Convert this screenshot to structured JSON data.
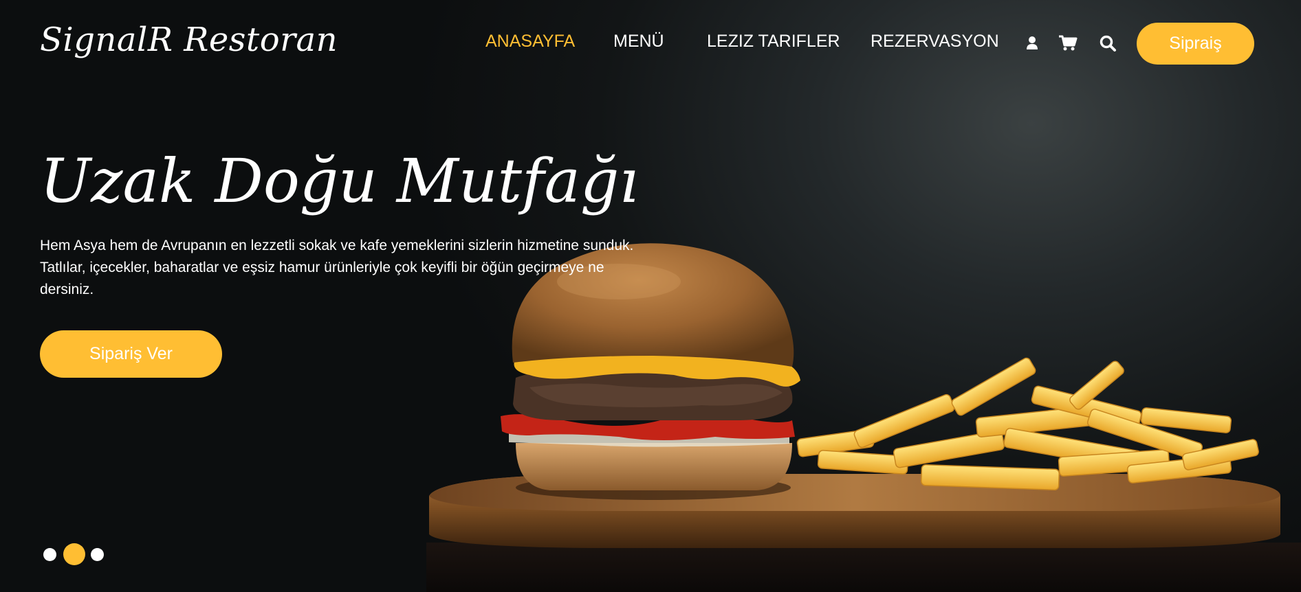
{
  "header": {
    "logo": "SignalR Restoran",
    "nav": [
      {
        "label": "ANASAYFA",
        "active": true
      },
      {
        "label": "MENÜ",
        "active": false
      },
      {
        "label": "LEZIZ TARIFLER",
        "active": false
      },
      {
        "label": "REZERVASYON",
        "active": false
      }
    ],
    "icons": [
      "user-icon",
      "cart-icon",
      "search-icon"
    ],
    "order_button": "Sipraiş"
  },
  "hero": {
    "title": "Uzak Doğu Mutfağı",
    "description": "Hem Asya hem de Avrupanın en lezzetli sokak ve kafe yemeklerini sizlerin hizmetine sunduk. Tatlılar, içecekler, baharatlar ve eşsiz hamur ürünleriyle çok keyifli bir öğün geçirmeye ne dersiniz.",
    "cta_button": "Sipariş Ver",
    "image": "burger-and-fries-image"
  },
  "slider": {
    "dot_count": 3,
    "active_index": 1
  },
  "colors": {
    "accent": "#ffbe33",
    "background": "#0d0f10",
    "text": "#ffffff"
  }
}
